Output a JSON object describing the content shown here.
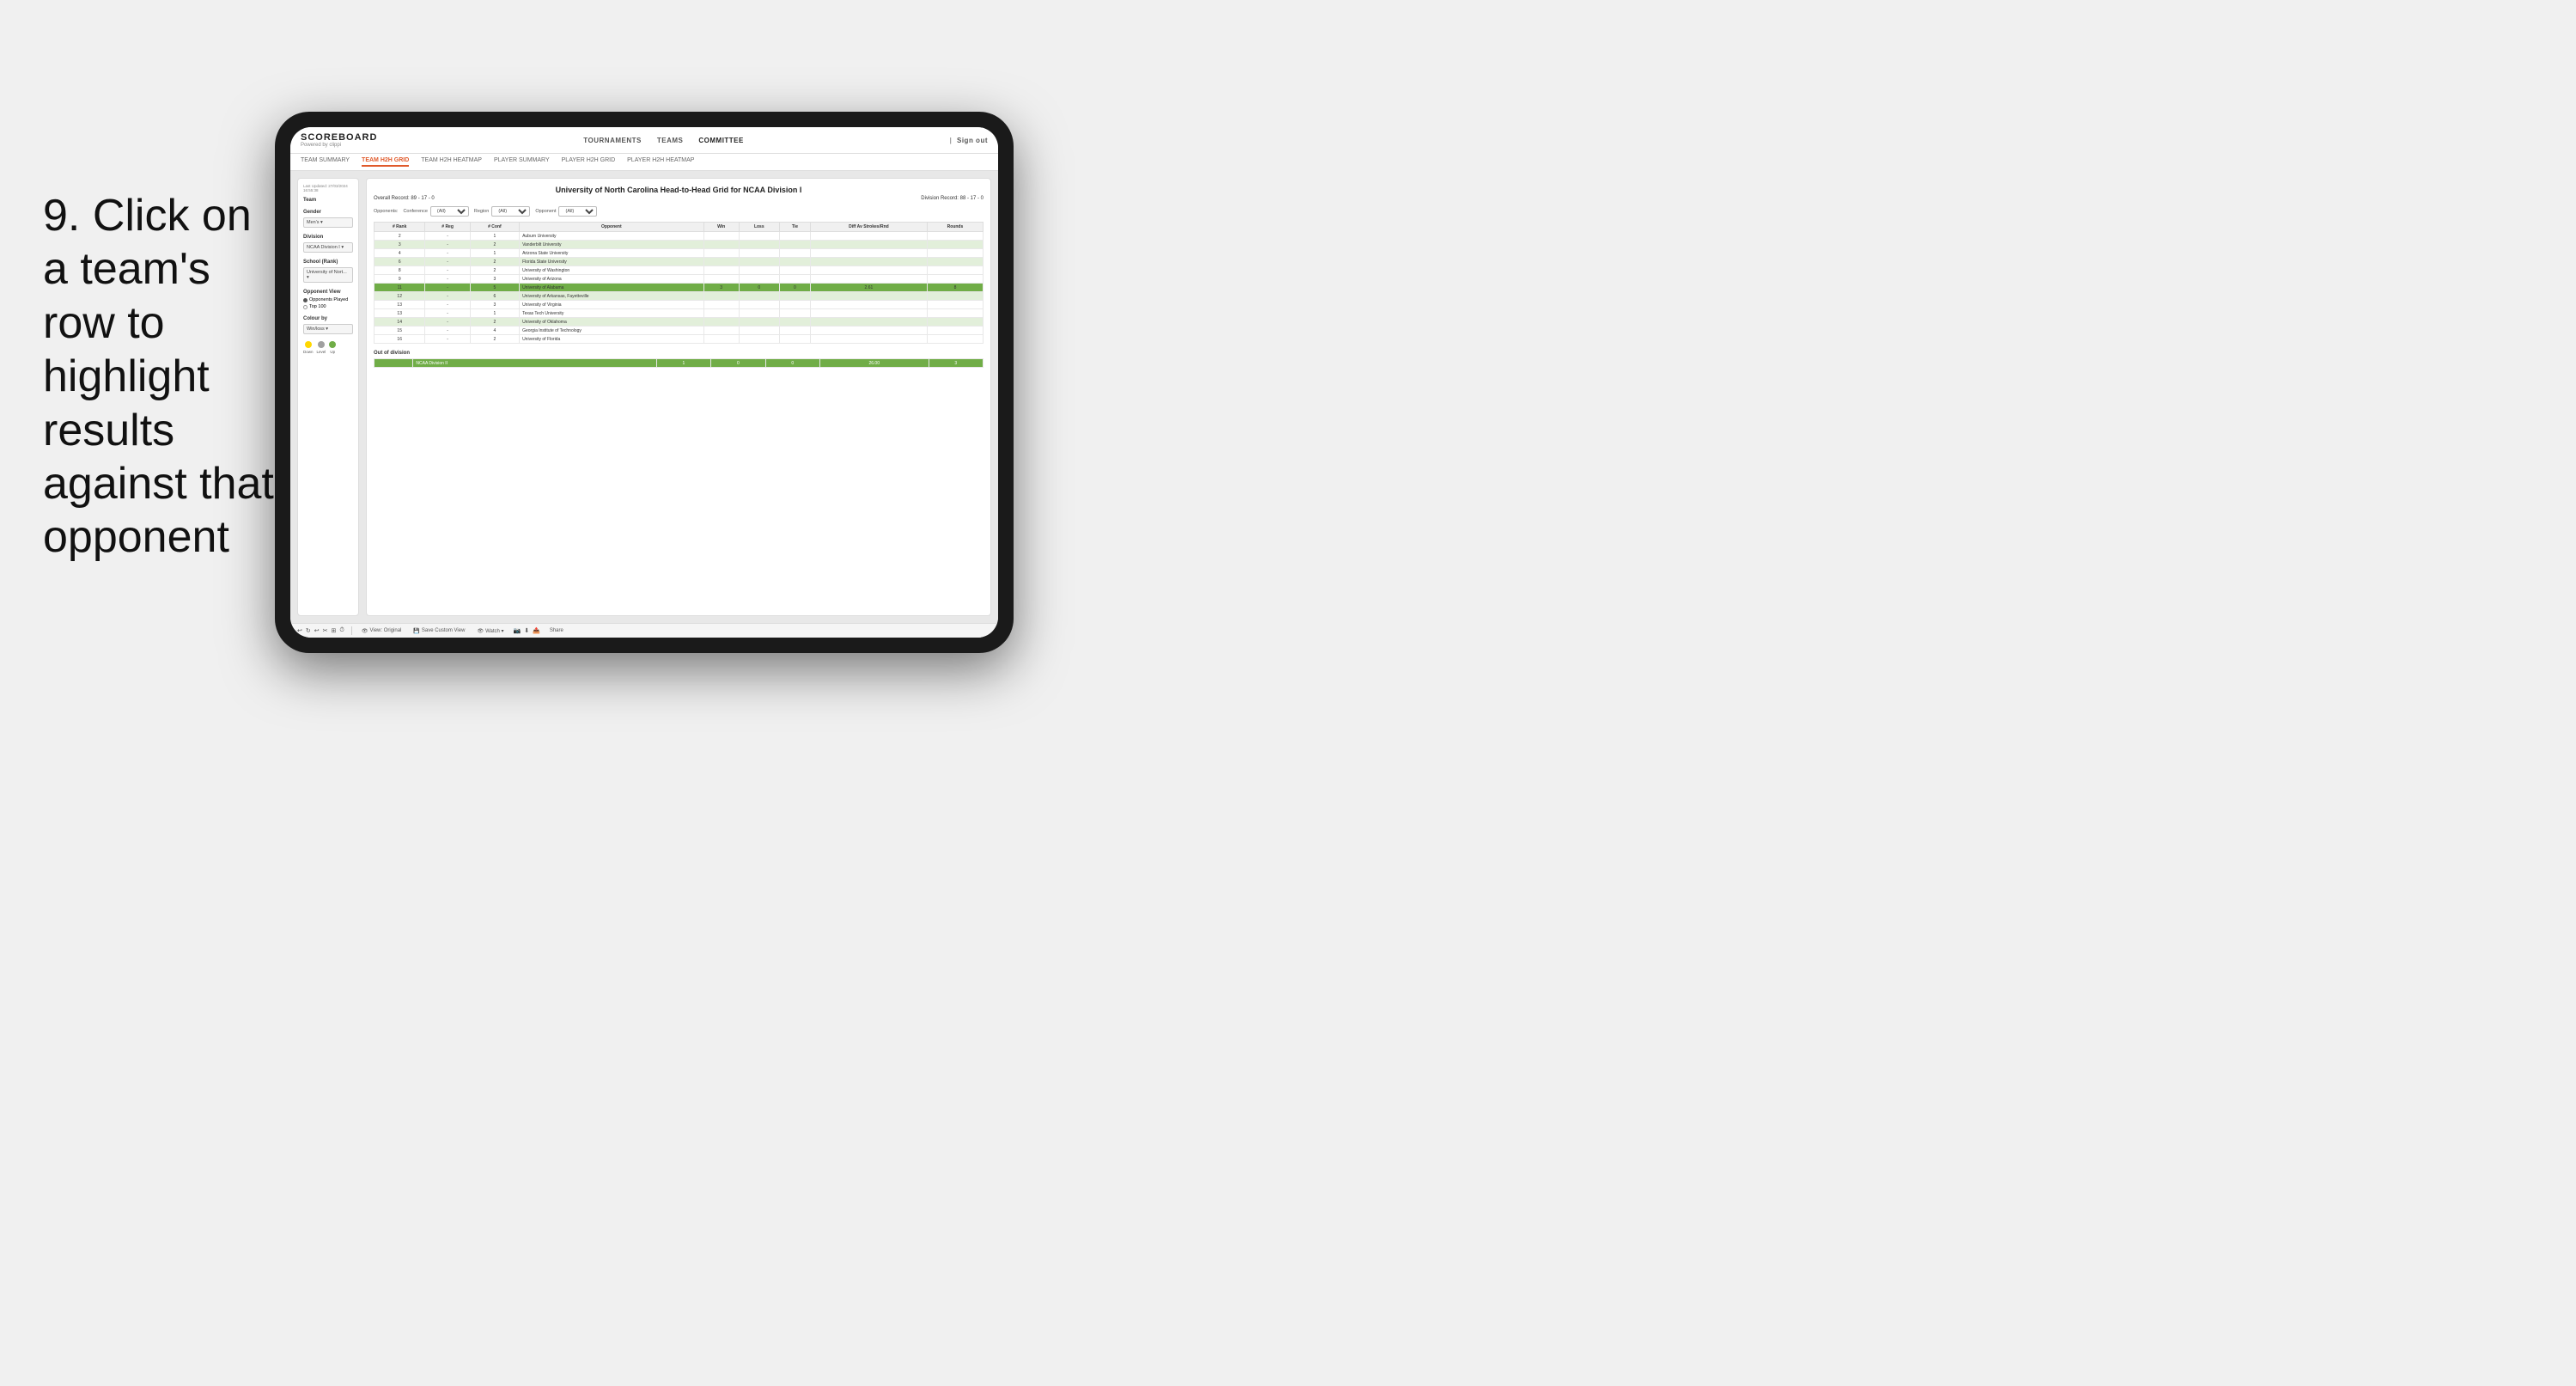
{
  "instruction": {
    "step": "9.",
    "text": "Click on a team's row to highlight results against that opponent"
  },
  "navbar": {
    "logo": "SCOREBOARD",
    "logo_sub": "Powered by clippi",
    "links": [
      "TOURNAMENTS",
      "TEAMS",
      "COMMITTEE"
    ],
    "sign_out": "Sign out"
  },
  "sub_tabs": [
    {
      "label": "TEAM SUMMARY",
      "active": false
    },
    {
      "label": "TEAM H2H GRID",
      "active": true
    },
    {
      "label": "TEAM H2H HEATMAP",
      "active": false
    },
    {
      "label": "PLAYER SUMMARY",
      "active": false
    },
    {
      "label": "PLAYER H2H GRID",
      "active": false
    },
    {
      "label": "PLAYER H2H HEATMAP",
      "active": false
    }
  ],
  "left_panel": {
    "last_updated": "Last Updated: 27/03/2024",
    "time": "16:55:38",
    "team_label": "Team",
    "gender_label": "Gender",
    "gender_value": "Men's",
    "division_label": "Division",
    "division_value": "NCAA Division I",
    "school_label": "School (Rank)",
    "school_value": "University of Nort...",
    "opponent_view_label": "Opponent View",
    "opponent_view_options": [
      "Opponents Played",
      "Top 100"
    ],
    "colour_by_label": "Colour by",
    "colour_by_value": "Win/loss",
    "legend": [
      {
        "label": "Down",
        "color": "#ffd700"
      },
      {
        "label": "Level",
        "color": "#a0a0a0"
      },
      {
        "label": "Up",
        "color": "#70ad47"
      }
    ]
  },
  "main_grid": {
    "title": "University of North Carolina Head-to-Head Grid for NCAA Division I",
    "overall_record": "Overall Record: 89 - 17 - 0",
    "division_record": "Division Record: 88 - 17 - 0",
    "filters": {
      "opponents_label": "Opponents:",
      "conference_label": "Conference",
      "conference_value": "(All)",
      "region_label": "Region",
      "region_value": "(All)",
      "opponent_label": "Opponent",
      "opponent_value": "(All)"
    },
    "table_headers": [
      "# Rank",
      "# Reg",
      "# Conf",
      "Opponent",
      "Win",
      "Loss",
      "Tie",
      "Diff Av Strokes/Rnd",
      "Rounds"
    ],
    "rows": [
      {
        "rank": "2",
        "reg": "-",
        "conf": "1",
        "opponent": "Auburn University",
        "win": "",
        "loss": "",
        "tie": "",
        "diff": "",
        "rounds": "",
        "style": "normal"
      },
      {
        "rank": "3",
        "reg": "-",
        "conf": "2",
        "opponent": "Vanderbilt University",
        "win": "",
        "loss": "",
        "tie": "",
        "diff": "",
        "rounds": "",
        "style": "light-green"
      },
      {
        "rank": "4",
        "reg": "-",
        "conf": "1",
        "opponent": "Arizona State University",
        "win": "",
        "loss": "",
        "tie": "",
        "diff": "",
        "rounds": "",
        "style": "normal"
      },
      {
        "rank": "6",
        "reg": "-",
        "conf": "2",
        "opponent": "Florida State University",
        "win": "",
        "loss": "",
        "tie": "",
        "diff": "",
        "rounds": "",
        "style": "light-green"
      },
      {
        "rank": "8",
        "reg": "-",
        "conf": "2",
        "opponent": "University of Washington",
        "win": "",
        "loss": "",
        "tie": "",
        "diff": "",
        "rounds": "",
        "style": "normal"
      },
      {
        "rank": "9",
        "reg": "-",
        "conf": "3",
        "opponent": "University of Arizona",
        "win": "",
        "loss": "",
        "tie": "",
        "diff": "",
        "rounds": "",
        "style": "normal"
      },
      {
        "rank": "11",
        "reg": "-",
        "conf": "5",
        "opponent": "University of Alabama",
        "win": "3",
        "loss": "0",
        "tie": "0",
        "diff": "2.61",
        "rounds": "8",
        "style": "highlighted"
      },
      {
        "rank": "12",
        "reg": "-",
        "conf": "6",
        "opponent": "University of Arkansas, Fayetteville",
        "win": "",
        "loss": "",
        "tie": "",
        "diff": "",
        "rounds": "",
        "style": "light-green"
      },
      {
        "rank": "13",
        "reg": "-",
        "conf": "3",
        "opponent": "University of Virginia",
        "win": "",
        "loss": "",
        "tie": "",
        "diff": "",
        "rounds": "",
        "style": "normal"
      },
      {
        "rank": "13",
        "reg": "-",
        "conf": "1",
        "opponent": "Texas Tech University",
        "win": "",
        "loss": "",
        "tie": "",
        "diff": "",
        "rounds": "",
        "style": "normal"
      },
      {
        "rank": "14",
        "reg": "-",
        "conf": "2",
        "opponent": "University of Oklahoma",
        "win": "",
        "loss": "",
        "tie": "",
        "diff": "",
        "rounds": "",
        "style": "light-green"
      },
      {
        "rank": "15",
        "reg": "-",
        "conf": "4",
        "opponent": "Georgia Institute of Technology",
        "win": "",
        "loss": "",
        "tie": "",
        "diff": "",
        "rounds": "",
        "style": "normal"
      },
      {
        "rank": "16",
        "reg": "-",
        "conf": "2",
        "opponent": "University of Florida",
        "win": "",
        "loss": "",
        "tie": "",
        "diff": "",
        "rounds": "",
        "style": "normal"
      }
    ],
    "out_of_division_label": "Out of division",
    "out_of_division_row": {
      "label": "NCAA Division II",
      "win": "1",
      "loss": "0",
      "tie": "0",
      "diff": "26.00",
      "rounds": "3"
    }
  },
  "toolbar": {
    "buttons": [
      "View: Original",
      "Save Custom View",
      "Watch",
      "Share"
    ]
  }
}
